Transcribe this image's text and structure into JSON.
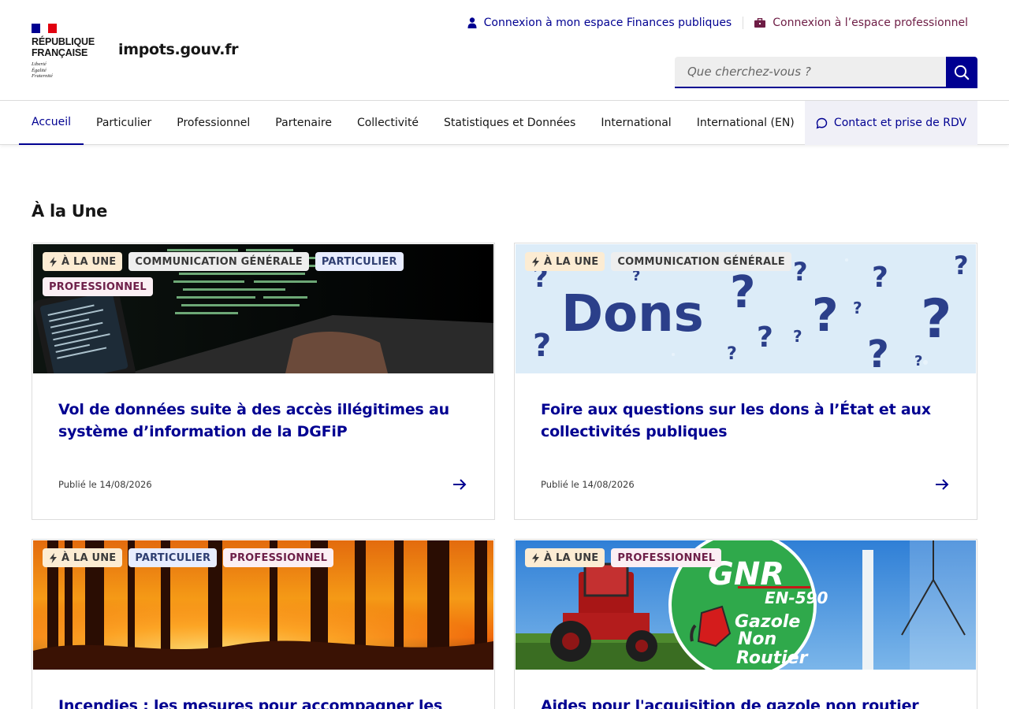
{
  "header": {
    "logo_text": [
      "RÉPUBLIQUE",
      "FRANÇAISE"
    ],
    "devise": [
      "Liberté",
      "Égalité",
      "Fraternité"
    ],
    "site_name": "impots.gouv.fr",
    "login_particulier": "Connexion à mon espace Finances publiques",
    "login_pro": "Connexion à l’espace professionnel",
    "search_placeholder": "Que cherchez-vous ?",
    "icons": {
      "particulier": "person-icon",
      "pro": "briefcase-icon",
      "search": "search-icon"
    }
  },
  "nav": {
    "items": [
      "Accueil",
      "Particulier",
      "Professionnel",
      "Partenaire",
      "Collectivité",
      "Statistiques et Données",
      "International",
      "International (EN)"
    ],
    "active": "Accueil",
    "contact": "Contact et prise de RDV"
  },
  "main": {
    "section_title": "À la Une",
    "cards": [
      {
        "tags": [
          "À LA UNE",
          "COMMUNICATION GÉNÉRALE",
          "PARTICULIER",
          "PROFESSIONNEL"
        ],
        "title": "Vol de données suite à des accès illégitimes au système d’information de la DGFiP",
        "date": "Publié le 14/08/2026"
      },
      {
        "tags": [
          "À LA UNE",
          "COMMUNICATION GÉNÉRALE"
        ],
        "image_text": "Dons",
        "title": "Foire aux questions sur les dons à l’État et aux collectivités publiques",
        "date": "Publié le 14/08/2026"
      },
      {
        "tags": [
          "À LA UNE",
          "PARTICULIER",
          "PROFESSIONNEL"
        ],
        "title": "Incendies : les mesures pour accompagner les"
      },
      {
        "tags": [
          "À LA UNE",
          "PROFESSIONNEL"
        ],
        "image_text": [
          "GNR",
          "EN-590",
          "Gazole",
          "Non",
          "Routier"
        ],
        "title": "Aides pour l'acquisition de gazole non routier"
      }
    ]
  },
  "colors": {
    "primary": "#000091",
    "pro": "#6e1d45",
    "tag_une": "#fcecd3",
    "tag_comm": "#eeeeee",
    "tag_part": "#e8edff",
    "tag_pro": "#fbeff4"
  }
}
